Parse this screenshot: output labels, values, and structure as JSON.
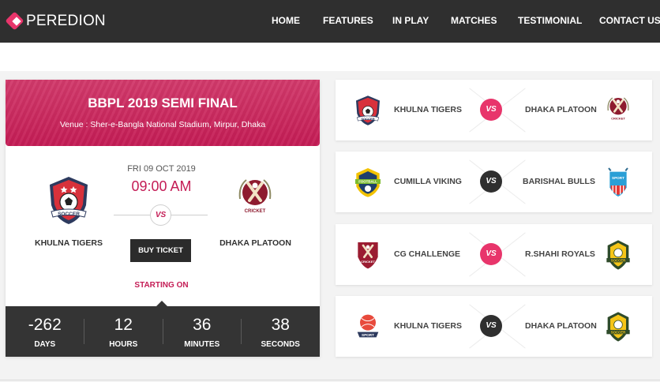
{
  "brand": {
    "name": "PEREDION",
    "accent": "#e8356b"
  },
  "nav": {
    "items": [
      "HOME",
      "FEATURES",
      "IN PLAY",
      "MATCHES",
      "TESTIMONIAL",
      "CONTACT US"
    ]
  },
  "featured": {
    "title": "BBPL 2019 SEMI FINAL",
    "venue": "Venue : Sher-e-Bangla National Stadium, Mirpur, Dhaka",
    "date": "FRI 09 OCT 2019",
    "time": "09:00 AM",
    "vs": "VS",
    "home": {
      "name": "KHULNA TIGERS",
      "logo": "soccer-shield-logo",
      "logo_text": "SOCCER"
    },
    "away": {
      "name": "DHAKA PLATOON",
      "logo": "cricket-club-logo",
      "logo_text": "CRICKET"
    },
    "buy_label": "BUY TICKET",
    "starting_label": "STARTING ON",
    "countdown": [
      {
        "value": "-262",
        "label": "DAYS"
      },
      {
        "value": "12",
        "label": "HOURS"
      },
      {
        "value": "36",
        "label": "MINUTES"
      },
      {
        "value": "38",
        "label": "SECONDS"
      }
    ]
  },
  "matches": [
    {
      "home": "KHULNA TIGERS",
      "away": "DHAKA PLATOON",
      "vs": "VS",
      "vs_color": "#e8356b",
      "home_logo": "soccer-shield-logo",
      "away_logo": "cricket-club-logo"
    },
    {
      "home": "CUMILLA VIKING",
      "away": "BARISHAL BULLS",
      "vs": "VS",
      "vs_color": "#2f2f2f",
      "home_logo": "football-badge-logo",
      "away_logo": "sport-shield-logo"
    },
    {
      "home": "CG CHALLENGE",
      "away": "R.SHAHI ROYALS",
      "vs": "VS",
      "vs_color": "#e8356b",
      "home_logo": "cricket-club-logo",
      "away_logo": "soccer-crest-logo"
    },
    {
      "home": "KHULNA TIGERS",
      "away": "DHAKA PLATOON",
      "vs": "VS",
      "vs_color": "#2f2f2f",
      "home_logo": "sport-ball-logo",
      "away_logo": "soccer-crest-logo"
    }
  ],
  "logo_words": {
    "soccer": "SOCCER",
    "cricket": "CRICKET",
    "football": "FOOTBALL",
    "sport": "SPORT"
  }
}
